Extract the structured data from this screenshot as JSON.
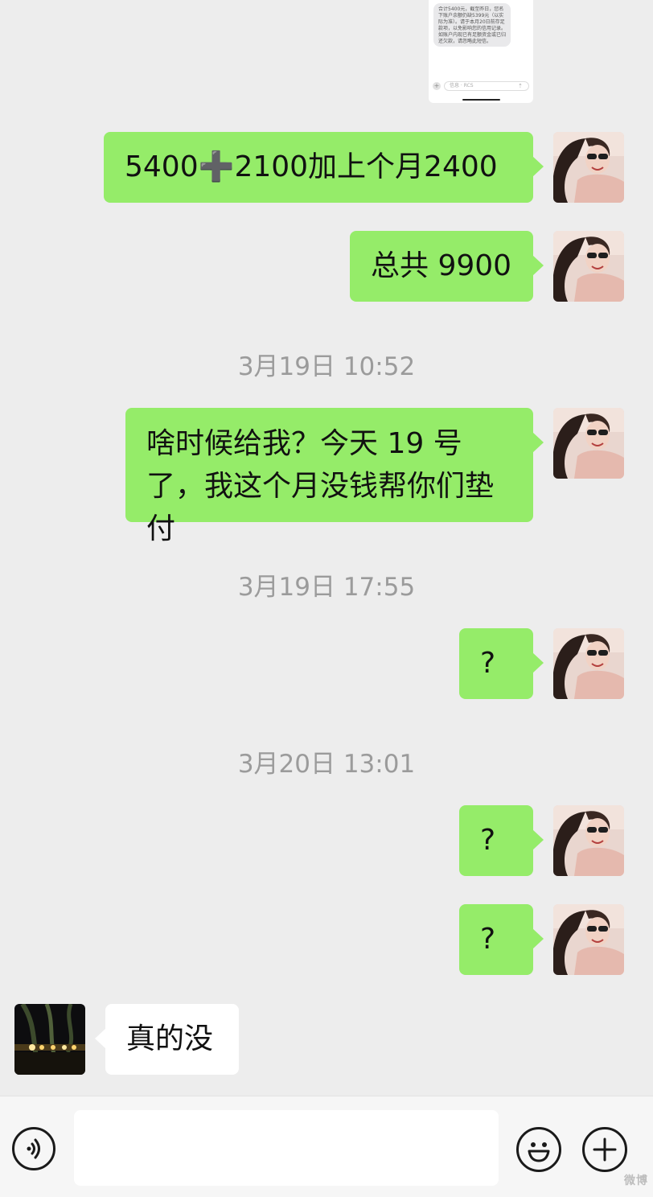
{
  "colors": {
    "background": "#ededed",
    "my_bubble": "#95ec69",
    "their_bubble": "#ffffff",
    "timestamp_text": "#9b9b9b"
  },
  "quoted_screenshot": {
    "sms_text": "合计5400元，截至昨日，您名下账户余额仍缺5399元（以实际为准）。请于本月20日前存足款项，以免影响您的信用记录。如账户内现已有足额资金或已归还欠款，请忽略此短信。",
    "input_placeholder": "信息 · RCS",
    "icons": [
      "plus-icon",
      "send-icon"
    ]
  },
  "messages": [
    {
      "sender": "me",
      "text": "5400➕2100加上个月2400"
    },
    {
      "sender": "me",
      "text": "总共 9900"
    },
    {
      "type": "time",
      "text": "3月19日 10:52"
    },
    {
      "sender": "me",
      "text": "啥时候给我？今天 19 号了，我这个月没钱帮你们垫付"
    },
    {
      "type": "time",
      "text": "3月19日 17:55"
    },
    {
      "sender": "me",
      "text": "?"
    },
    {
      "type": "time",
      "text": "3月20日 13:01"
    },
    {
      "sender": "me",
      "text": "?"
    },
    {
      "sender": "me",
      "text": "?"
    },
    {
      "sender": "other",
      "text": "真的没"
    }
  ],
  "avatars": {
    "me": "woman-with-sunglasses-avatar",
    "other": "night-scene-willow-avatar"
  },
  "input_bar": {
    "value": "",
    "icons": [
      "voice-icon",
      "emoji-icon",
      "plus-icon"
    ]
  },
  "watermark": "微博"
}
